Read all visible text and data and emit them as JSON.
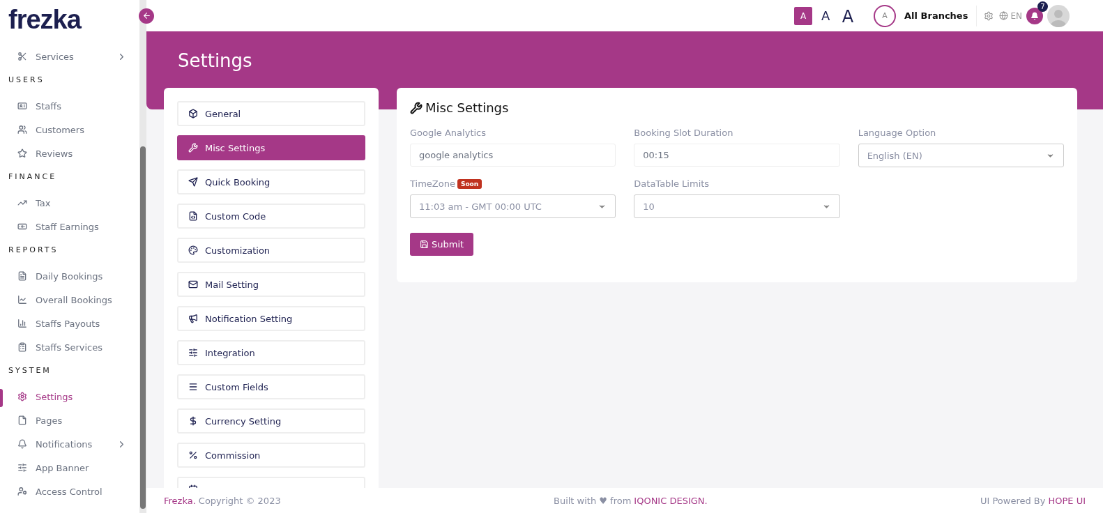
{
  "brand": {
    "logo": "frezka"
  },
  "sidebar": {
    "sections": [
      {
        "items": [
          {
            "label": "Services",
            "selected": false,
            "expandable": true
          }
        ]
      },
      {
        "title": "USERS",
        "items": [
          {
            "label": "Staffs",
            "selected": false,
            "expandable": false
          },
          {
            "label": "Customers",
            "selected": false,
            "expandable": false
          },
          {
            "label": "Reviews",
            "selected": false,
            "expandable": false
          }
        ]
      },
      {
        "title": "FINANCE",
        "items": [
          {
            "label": "Tax",
            "selected": false,
            "expandable": false
          },
          {
            "label": "Staff Earnings",
            "selected": false,
            "expandable": false
          }
        ]
      },
      {
        "title": "REPORTS",
        "items": [
          {
            "label": "Daily Bookings",
            "selected": false,
            "expandable": false
          },
          {
            "label": "Overall Bookings",
            "selected": false,
            "expandable": false
          },
          {
            "label": "Staffs Payouts",
            "selected": false,
            "expandable": false
          },
          {
            "label": "Staffs Services",
            "selected": false,
            "expandable": false
          }
        ]
      },
      {
        "title": "SYSTEM",
        "items": [
          {
            "label": "Settings",
            "selected": true,
            "expandable": false
          },
          {
            "label": "Pages",
            "selected": false,
            "expandable": false
          },
          {
            "label": "Notifications",
            "selected": false,
            "expandable": true
          },
          {
            "label": "App Banner",
            "selected": false,
            "expandable": false
          },
          {
            "label": "Access Control",
            "selected": false,
            "expandable": false
          }
        ]
      }
    ]
  },
  "topbar": {
    "font_sizes": [
      {
        "label": "A",
        "selected": true
      },
      {
        "label": "A",
        "selected": false
      },
      {
        "label": "A",
        "selected": false
      }
    ],
    "branch_avatar": "A",
    "branch": "All Branches",
    "language": "EN",
    "notification_count": "7"
  },
  "page": {
    "title": "Settings"
  },
  "settings_menu": [
    {
      "label": "General",
      "selected": false
    },
    {
      "label": "Misc Settings",
      "selected": true
    },
    {
      "label": "Quick Booking",
      "selected": false
    },
    {
      "label": "Custom Code",
      "selected": false
    },
    {
      "label": "Customization",
      "selected": false
    },
    {
      "label": "Mail Setting",
      "selected": false
    },
    {
      "label": "Notification Setting",
      "selected": false
    },
    {
      "label": "Integration",
      "selected": false
    },
    {
      "label": "Custom Fields",
      "selected": false
    },
    {
      "label": "Currency Setting",
      "selected": false
    },
    {
      "label": "Commission",
      "selected": false
    }
  ],
  "misc": {
    "title": "Misc Settings",
    "fields": [
      {
        "label": "Google Analytics",
        "kind": "text",
        "value": "google analytics"
      },
      {
        "label": "Booking Slot Duration",
        "kind": "text",
        "value": "00:15"
      },
      {
        "label": "Language Option",
        "kind": "select",
        "value": "English (EN)"
      },
      {
        "label": "TimeZone",
        "badge": "Soon",
        "kind": "select",
        "value": "11:03 am - GMT 00:00 UTC"
      },
      {
        "label": "DataTable Limits",
        "kind": "select",
        "value": "10"
      }
    ],
    "submit": "Submit"
  },
  "footer": {
    "brand": "Frezka.",
    "copyright": "Copyright © 2023",
    "built_with": "Built with ♥ from",
    "company": "IQONIC DESIGN.",
    "powered_by": "UI Powered By",
    "powered_link": "HOPE UI"
  }
}
